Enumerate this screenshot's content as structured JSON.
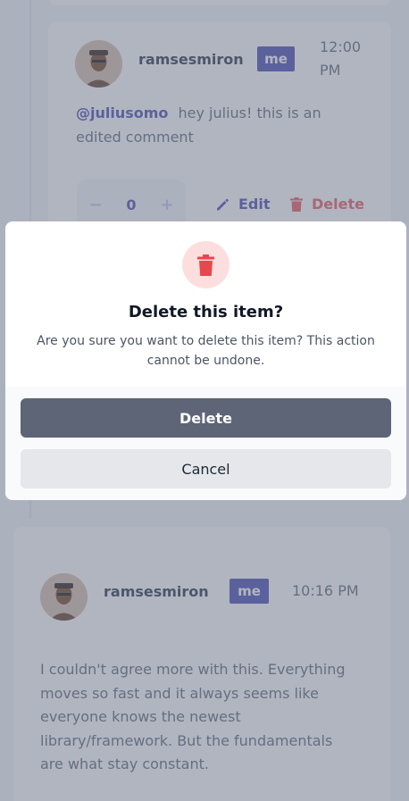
{
  "reply": {
    "username": "ramsesmiron",
    "badge": "me",
    "time_line1": "12:00",
    "time_line2": "PM",
    "mention": "@juliusomo",
    "text_line1": "hey julius! this is an",
    "text_line2": "edited comment",
    "score": "0",
    "score_minus": "−",
    "score_plus": "+",
    "edit_label": "Edit",
    "delete_label": "Delete"
  },
  "comment": {
    "username": "ramsesmiron",
    "badge": "me",
    "time": "10:16 PM",
    "text_lines": [
      "I couldn't agree more with this. Everything",
      "moves so fast and it always seems like",
      "everyone knows the newest",
      "library/framework. But the fundamentals",
      "are what stay constant."
    ]
  },
  "modal": {
    "icon": "trash-icon",
    "title": "Delete this item?",
    "message_line1": "Are you sure you want to delete this item? This action",
    "message_line2": "cannot be undone.",
    "confirm_label": "Delete",
    "cancel_label": "Cancel"
  },
  "colors": {
    "accent": "#5357b6",
    "danger": "#ed6368",
    "danger_icon": "#e5484d",
    "overlay": "#646c82",
    "confirm_button": "#5d6577"
  }
}
